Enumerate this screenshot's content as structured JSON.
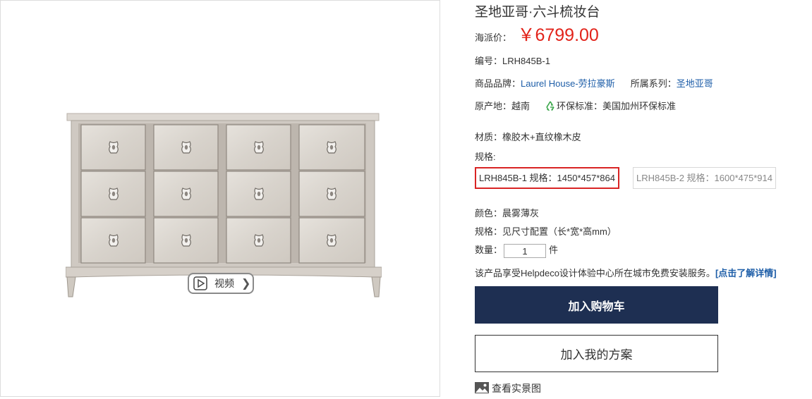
{
  "product": {
    "title": "圣地亚哥·六斗梳妆台",
    "price_label": "海派价：",
    "price": "￥6799.00",
    "sku_label": "编号：",
    "sku": "LRH845B-1",
    "brand_label": "商品品牌：",
    "brand": "Laurel House-劳拉豪斯",
    "series_label": "所属系列：",
    "series": "圣地亚哥",
    "origin_label": "原产地：",
    "origin": "越南",
    "eco_label": "环保标准：",
    "eco": "美国加州环保标准",
    "material_label": "材质：",
    "material": "橡胶木+直纹橡木皮",
    "spec_label": "规格:",
    "spec_options": [
      {
        "label": "LRH845B-1 规格：1450*457*864",
        "selected": true
      },
      {
        "label": "LRH845B-2 规格：1600*475*914",
        "selected": false
      }
    ],
    "color_label": "颜色：",
    "color": "晨雾薄灰",
    "size_label": "规格：",
    "size": "见尺寸配置（长*宽*高mm）",
    "qty_label": "数量：",
    "qty": "1",
    "qty_unit": "件",
    "install_notice": "该产品享受Helpdeco设计体验中心所在城市免费安装服务。",
    "install_link": "[点击了解详情]"
  },
  "gallery": {
    "video_label": "视频"
  },
  "actions": {
    "add_to_cart": "加入购物车",
    "add_to_plan": "加入我的方案",
    "view_photos": "查看实景图"
  },
  "colors": {
    "price": "#e2231a",
    "link": "#1e5ea8",
    "cart_button": "#1e2f52",
    "selected_border": "#d92424"
  },
  "icons": [
    "play-icon",
    "chevron-right-icon",
    "recycle-icon",
    "image-icon",
    "drawer-handle-icon"
  ]
}
